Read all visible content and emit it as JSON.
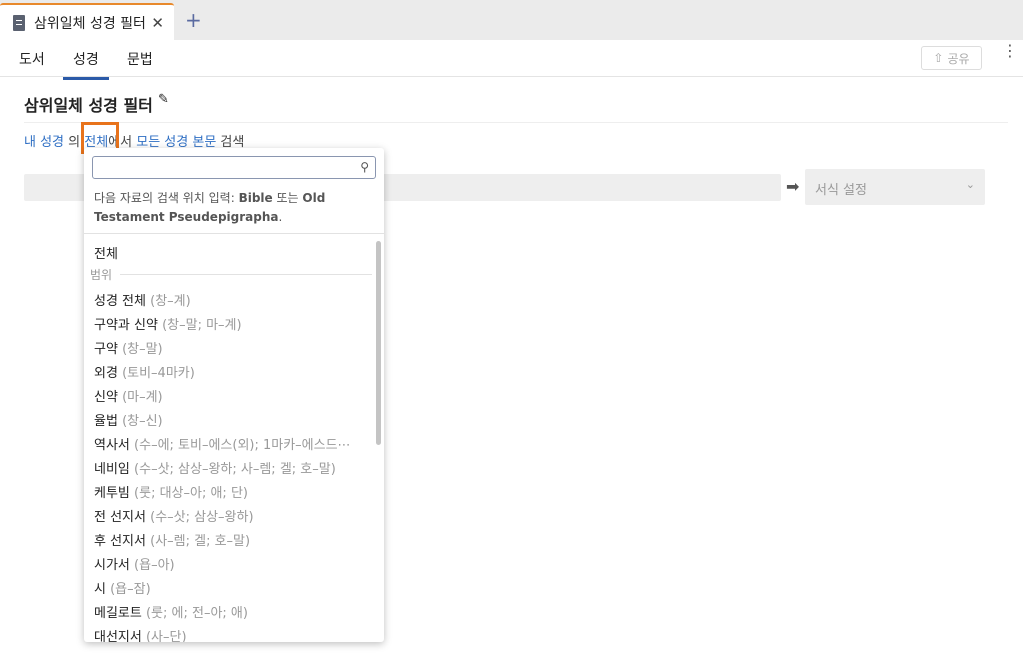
{
  "tabbar": {
    "tab_title": "삼위일체 성경 필터",
    "close_glyph": "✕",
    "new_tab_glyph": "+"
  },
  "subnav": {
    "tabs": [
      {
        "label": "도서"
      },
      {
        "label": "성경"
      },
      {
        "label": "문법"
      }
    ],
    "active_tab": "성경",
    "share_label": "공유",
    "more_glyph": "⋮"
  },
  "page": {
    "title": "삼위일체 성경 필터",
    "edit_icon": "pencil-icon"
  },
  "query": {
    "source": "내 성경",
    "particle_1": "의",
    "scope": "전체",
    "particle_2": "에서",
    "target": "모든 성경 본문",
    "verb": "검색"
  },
  "toolbar": {
    "arrow_glyph": "➡",
    "format_label": "서식 설정"
  },
  "dropdown": {
    "search_placeholder": "",
    "hint_prefix": "다음 자료의 검색 위치 입력: ",
    "hint_bible": "Bible",
    "hint_or": " 또는 ",
    "hint_ot": "Old Testament Pseudepigrapha",
    "hint_suffix": ".",
    "all_label": "전체",
    "group_label": "범위",
    "items": [
      {
        "label": "성경 전체",
        "range": "(창–계)"
      },
      {
        "label": "구약과 신약",
        "range": "(창–말; 마–계)"
      },
      {
        "label": "구약",
        "range": "(창–말)"
      },
      {
        "label": "외경",
        "range": "(토비–4마카)"
      },
      {
        "label": "신약",
        "range": "(마–계)"
      },
      {
        "label": "율법",
        "range": "(창–신)"
      },
      {
        "label": "역사서",
        "range": "(수–에; 토비–에스(외); 1마카–에스드⋯"
      },
      {
        "label": "네비임",
        "range": "(수–삿; 삼상–왕하; 사–렘; 겔; 호–말)"
      },
      {
        "label": "케투빔",
        "range": "(룻; 대상–아; 애; 단)"
      },
      {
        "label": "전 선지서",
        "range": "(수–삿; 삼상–왕하)"
      },
      {
        "label": "후 선지서",
        "range": "(사–렘; 겔; 호–말)"
      },
      {
        "label": "시가서",
        "range": "(욥–아)"
      },
      {
        "label": "시",
        "range": "(욥–잠)"
      },
      {
        "label": "메길로트",
        "range": "(룻; 에; 전–아; 애)"
      },
      {
        "label": "대선지서",
        "range": "(사–단)"
      }
    ]
  }
}
